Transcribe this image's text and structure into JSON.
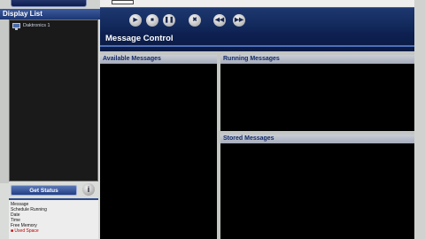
{
  "left_panel": {
    "header": "Display List",
    "items": [
      {
        "label": "Daktronics 1",
        "icon": "monitor-icon"
      }
    ],
    "get_status_label": "Get Status",
    "info_label": "i",
    "status_lines": [
      "Message",
      "Schedule Running",
      "Date",
      "Time",
      "Free Memory"
    ],
    "used_label": "Used Space"
  },
  "toolbar": {
    "buttons": [
      {
        "name": "play-button",
        "glyph": "▶"
      },
      {
        "name": "stop-button",
        "glyph": "■"
      },
      {
        "name": "pause-button",
        "glyph": "❚❚"
      },
      {
        "name": "delete-button",
        "glyph": "✖"
      },
      {
        "name": "back-button",
        "glyph": "◀◀"
      },
      {
        "name": "forward-button",
        "glyph": "▶▶"
      }
    ]
  },
  "main": {
    "title": "Message Control",
    "available_header": "Available Messages",
    "running_header": "Running Messages",
    "stored_header": "Stored Messages"
  },
  "colors": {
    "accent": "#1d3870",
    "header_text": "#132a66",
    "pane_bg": "#000000"
  }
}
